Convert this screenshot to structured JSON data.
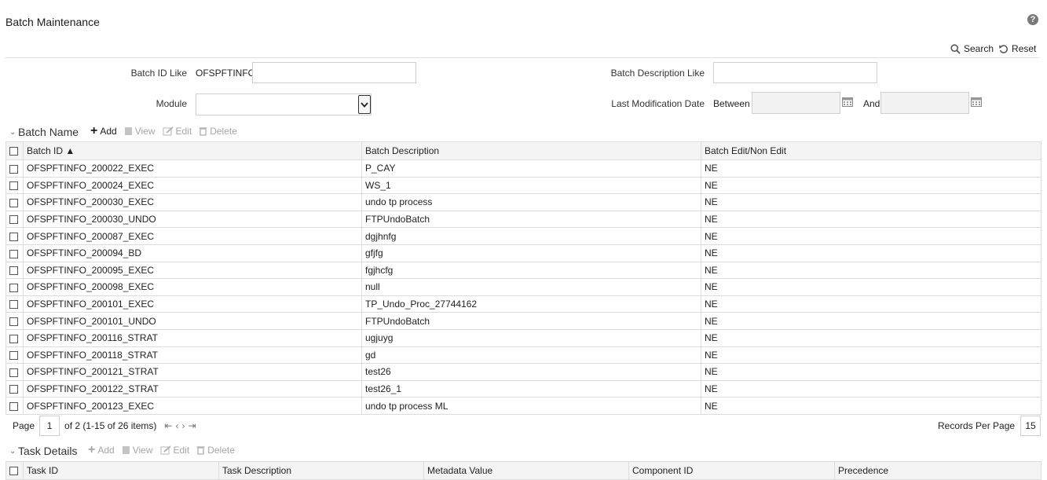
{
  "page": {
    "title": "Batch Maintenance",
    "help": "?"
  },
  "search": {
    "search_label": "Search",
    "reset_label": "Reset",
    "batch_id_label": "Batch ID Like",
    "batch_id_value": "OFSPFTINFO_",
    "batch_desc_label": "Batch Description Like",
    "batch_desc_value": "",
    "module_label": "Module",
    "module_value": "",
    "last_mod_label": "Last Modification Date",
    "between_label": "Between",
    "and_label": "And",
    "date_from": "",
    "date_to": ""
  },
  "batch_section": {
    "title": "Batch Name",
    "toolbar": {
      "add": "Add",
      "view": "View",
      "edit": "Edit",
      "delete": "Delete"
    },
    "columns": [
      "Batch ID ▲",
      "Batch Description",
      "Batch Edit/Non Edit"
    ],
    "rows": [
      [
        "OFSPFTINFO_200022_EXEC",
        "P_CAY",
        "NE"
      ],
      [
        "OFSPFTINFO_200024_EXEC",
        "WS_1",
        "NE"
      ],
      [
        "OFSPFTINFO_200030_EXEC",
        "undo tp process",
        "NE"
      ],
      [
        "OFSPFTINFO_200030_UNDO",
        "FTPUndoBatch",
        "NE"
      ],
      [
        "OFSPFTINFO_200087_EXEC",
        "dgjhnfg",
        "NE"
      ],
      [
        "OFSPFTINFO_200094_BD",
        "gfjfg",
        "NE"
      ],
      [
        "OFSPFTINFO_200095_EXEC",
        "fgjhcfg",
        "NE"
      ],
      [
        "OFSPFTINFO_200098_EXEC",
        "null",
        "NE"
      ],
      [
        "OFSPFTINFO_200101_EXEC",
        "TP_Undo_Proc_27744162",
        "NE"
      ],
      [
        "OFSPFTINFO_200101_UNDO",
        "FTPUndoBatch",
        "NE"
      ],
      [
        "OFSPFTINFO_200116_STRAT",
        "ugjuyg",
        "NE"
      ],
      [
        "OFSPFTINFO_200118_STRAT",
        "gd",
        "NE"
      ],
      [
        "OFSPFTINFO_200121_STRAT",
        "test26",
        "NE"
      ],
      [
        "OFSPFTINFO_200122_STRAT",
        "test26_1",
        "NE"
      ],
      [
        "OFSPFTINFO_200123_EXEC",
        "undo tp process ML",
        "NE"
      ]
    ],
    "pager": {
      "page_label": "Page",
      "page_value": "1",
      "summary": "of 2 (1-15 of 26 items)",
      "records_label": "Records Per Page",
      "records_value": "15"
    }
  },
  "task_section": {
    "title": "Task Details",
    "toolbar": {
      "add": "Add",
      "view": "View",
      "edit": "Edit",
      "delete": "Delete"
    },
    "columns": [
      "Task ID",
      "Task Description",
      "Metadata Value",
      "Component ID",
      "Precedence"
    ]
  }
}
